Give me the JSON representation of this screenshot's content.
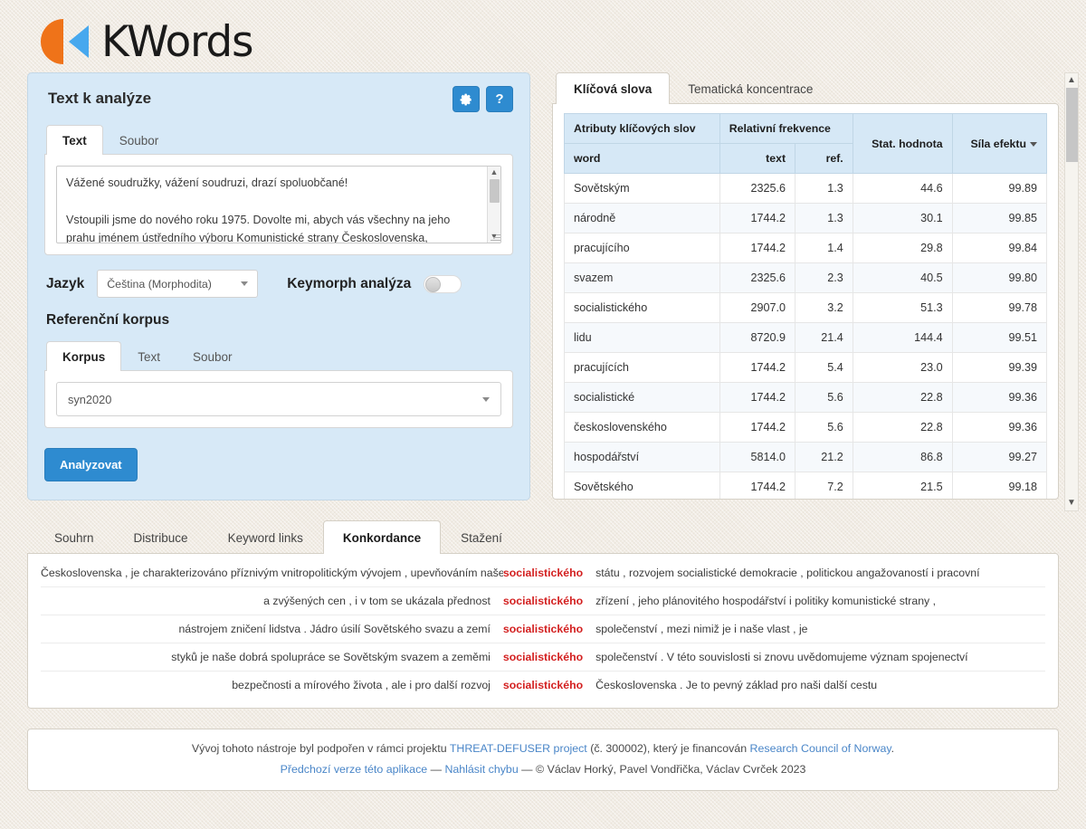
{
  "app": {
    "logo_text": "KWords",
    "logo_colors": {
      "orange": "#ef7319",
      "blue": "#47a8ee"
    }
  },
  "left_panel": {
    "title": "Text k analýze",
    "gear_icon": "gear-icon",
    "help_label": "?",
    "source_tabs": [
      {
        "id": "text",
        "label": "Text",
        "active": true
      },
      {
        "id": "soubor",
        "label": "Soubor",
        "active": false
      }
    ],
    "textarea_value": "Vážené soudružky, vážení soudruzi, drazí spoluobčané!\n\nVstoupili jsme do nového roku 1975. Dovolte mi, abych vás všechny na jeho prahu jménem ústředního výboru Komunistické strany Československa, ústředního výboru Národní fronty, jménem československé vlády i",
    "language_label": "Jazyk",
    "language_value": "Čeština (Morphodita)",
    "keymorph_label": "Keymorph analýza",
    "keymorph_on": false,
    "reference_corpus_label": "Referenční korpus",
    "corpus_tabs": [
      {
        "id": "korpus",
        "label": "Korpus",
        "active": true
      },
      {
        "id": "text",
        "label": "Text",
        "active": false
      },
      {
        "id": "soubor",
        "label": "Soubor",
        "active": false
      }
    ],
    "corpus_value": "syn2020",
    "analyze_label": "Analyzovat"
  },
  "right_panel": {
    "tabs": [
      {
        "id": "klicova-slova",
        "label": "Klíčová slova",
        "active": true
      },
      {
        "id": "tematicka-koncentrace",
        "label": "Tematická koncentrace",
        "active": false
      }
    ],
    "table": {
      "group_headers": [
        {
          "label": "Atributy klíčových slov",
          "colspan": 1
        },
        {
          "label": "Relativní frekvence",
          "colspan": 2
        },
        {
          "label": "Stat. hodnota",
          "colspan": 1,
          "rowspan": 2
        },
        {
          "label": "Síla efektu",
          "colspan": 1,
          "rowspan": 2,
          "sorted": true
        }
      ],
      "sub_headers": [
        "word",
        "text",
        "ref."
      ],
      "rows": [
        {
          "word": "Sovětským",
          "text": "2325.6",
          "ref": "1.3",
          "stat": "44.6",
          "effect": "99.89"
        },
        {
          "word": "národně",
          "text": "1744.2",
          "ref": "1.3",
          "stat": "30.1",
          "effect": "99.85"
        },
        {
          "word": "pracujícího",
          "text": "1744.2",
          "ref": "1.4",
          "stat": "29.8",
          "effect": "99.84"
        },
        {
          "word": "svazem",
          "text": "2325.6",
          "ref": "2.3",
          "stat": "40.5",
          "effect": "99.80"
        },
        {
          "word": "socialistického",
          "text": "2907.0",
          "ref": "3.2",
          "stat": "51.3",
          "effect": "99.78"
        },
        {
          "word": "lidu",
          "text": "8720.9",
          "ref": "21.4",
          "stat": "144.4",
          "effect": "99.51"
        },
        {
          "word": "pracujících",
          "text": "1744.2",
          "ref": "5.4",
          "stat": "23.0",
          "effect": "99.39"
        },
        {
          "word": "socialistické",
          "text": "1744.2",
          "ref": "5.6",
          "stat": "22.8",
          "effect": "99.36"
        },
        {
          "word": "československého",
          "text": "1744.2",
          "ref": "5.6",
          "stat": "22.8",
          "effect": "99.36"
        },
        {
          "word": "hospodářství",
          "text": "5814.0",
          "ref": "21.2",
          "stat": "86.8",
          "effect": "99.27"
        },
        {
          "word": "Sovětského",
          "text": "1744.2",
          "ref": "7.2",
          "stat": "21.5",
          "effect": "99.18"
        }
      ]
    }
  },
  "bottom": {
    "tabs": [
      {
        "id": "souhrn",
        "label": "Souhrn",
        "active": false
      },
      {
        "id": "distribuce",
        "label": "Distribuce",
        "active": false
      },
      {
        "id": "keyword-links",
        "label": "Keyword links",
        "active": false
      },
      {
        "id": "konkordance",
        "label": "Konkordance",
        "active": true
      },
      {
        "id": "stazeni",
        "label": "Stažení",
        "active": false
      }
    ],
    "concordance": [
      {
        "left": "Československa , je charakterizováno příznivým vnitropolitickým vývojem , upevňováním našeho",
        "kw": "socialistického",
        "right": "státu , rozvojem socialistické demokracie , politickou angažovaností i pracovní"
      },
      {
        "left": "a zvýšených cen , i v tom se ukázala přednost",
        "kw": "socialistického",
        "right": "zřízení , jeho plánovitého hospodářství i politiky komunistické strany ,"
      },
      {
        "left": "nástrojem zničení lidstva . Jádro úsilí Sovětského svazu a zemí",
        "kw": "socialistického",
        "right": "společenství , mezi nimiž je i naše vlast , je"
      },
      {
        "left": "styků je naše dobrá spolupráce se Sovětským svazem a zeměmi",
        "kw": "socialistického",
        "right": "společenství . V této souvislosti si znovu uvědomujeme význam spojenectví"
      },
      {
        "left": "bezpečnosti a mírového života , ale i pro další rozvoj",
        "kw": "socialistického",
        "right": "Československa . Je to pevný základ pro naši další cestu"
      }
    ]
  },
  "footer": {
    "line1_part1": "Vývoj tohoto nástroje byl podpořen v rámci projektu ",
    "line1_link1": "THREAT-DEFUSER project",
    "line1_part2": " (č. 300002), který je financován ",
    "line1_link2": "Research Council of Norway",
    "line1_part3": ".",
    "line2_link1": "Předchozí verze této aplikace",
    "line2_sep1": " — ",
    "line2_link2": "Nahlásit chybu",
    "line2_part": " — © Václav Horký, Pavel Vondřička, Václav Cvrček 2023"
  }
}
